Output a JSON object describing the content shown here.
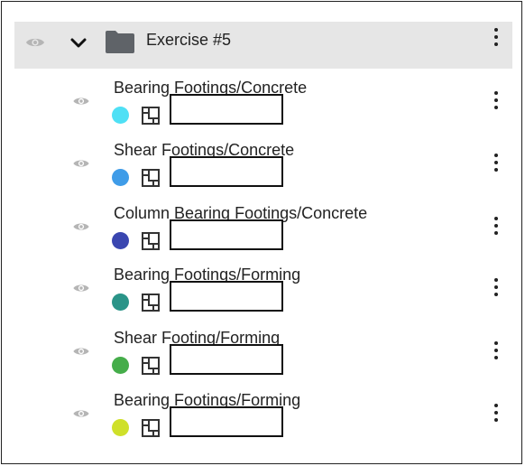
{
  "folder": {
    "name": "Exercise #5",
    "icons": {
      "visibility": "eye-icon",
      "expand": "chevron-down-icon",
      "folder": "folder-icon",
      "menu": "more-vertical-icon"
    }
  },
  "layers": [
    {
      "name": "Bearing Footings/Concrete",
      "color": "#4fe0f5"
    },
    {
      "name": "Shear Footings/Concrete",
      "color": "#3f9ce8"
    },
    {
      "name": "Column Bearing Footings/Concrete",
      "color": "#3a46b0"
    },
    {
      "name": "Bearing Footings/Forming",
      "color": "#2a9488"
    },
    {
      "name": "Shear Footing/Forming",
      "color": "#45ad4a"
    },
    {
      "name": "Bearing Footings/Forming",
      "color": "#cfe02a"
    }
  ],
  "layer_icons": {
    "visibility": "eye-icon",
    "assembly": "assembly-icon",
    "menu": "more-vertical-icon"
  },
  "colors": {
    "folder_row_bg": "#e6e6e6",
    "folder_icon": "#5f6368",
    "eye_icon": "#b5b5b5"
  }
}
